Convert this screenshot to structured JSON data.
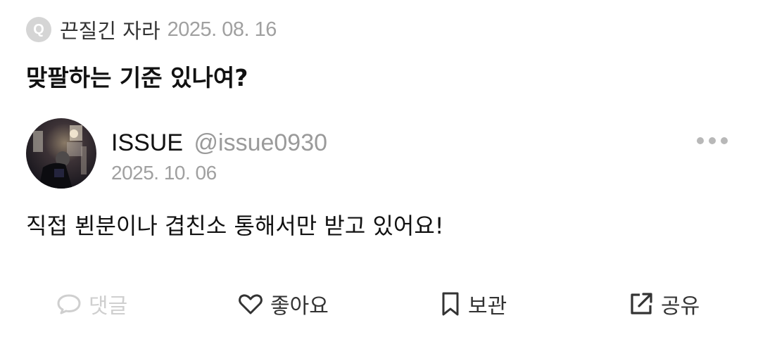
{
  "question": {
    "badge_letter": "Q",
    "author": "끈질긴 자라",
    "date": "2025. 08. 16",
    "title": "맞팔하는 기준 있나여?"
  },
  "answer": {
    "user_name": "ISSUE",
    "user_handle": "@issue0930",
    "date": "2025. 10. 06",
    "body": "직접 뵌분이나 겹친소 통해서만 받고 있어요!"
  },
  "actions": {
    "comment_label": "댓글",
    "like_label": "좋아요",
    "save_label": "보관",
    "share_label": "공유"
  },
  "icons": {
    "q_badge": "question-badge-icon",
    "more": "more-dots-icon",
    "comment": "speech-bubble-icon",
    "like": "heart-outline-icon",
    "save": "bookmark-icon",
    "share": "share-external-icon"
  },
  "colors": {
    "badge_bg": "#d5d5d5",
    "muted_text": "#a0a0a0",
    "disabled_action": "#cfcfcf",
    "primary_text": "#111111"
  }
}
